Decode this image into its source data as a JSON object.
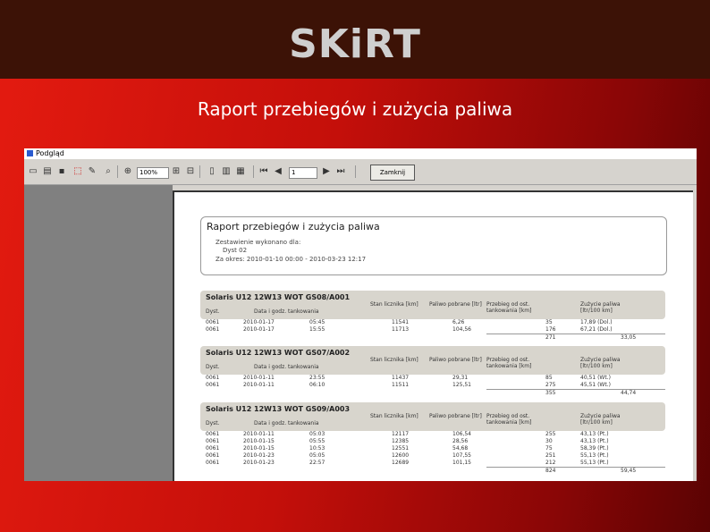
{
  "slide": {
    "brand": "SKiRT",
    "subtitle": "Raport przebiegów i zużycia paliwa"
  },
  "window": {
    "title": "Podgląd",
    "toolbar": {
      "zoom_value": "100%",
      "page_value": "1",
      "close_label": "Zamknij"
    }
  },
  "report": {
    "title": "Raport przebiegów i zużycia paliwa",
    "line1": "Zestawienie wykonano dla:",
    "line2": "Dyst 02",
    "line3": "Za okres: 2010-01-10 00:00 - 2010-03-23 12:17",
    "columns": [
      "Dyst.",
      "Data i godz. tankowania",
      "Stan licznika [km]",
      "Paliwo pobrane [ltr]",
      "Przebieg od ost. tankowania [km]",
      "Zużycie paliwa [ltr/100 km]"
    ],
    "groups": [
      {
        "name": "Solaris U12 12W13 WOT GS08/A001",
        "rows": [
          [
            "0061",
            "2010-01-17",
            "05:45",
            "11541",
            "6,26",
            "35",
            "17,89 (Dol.)"
          ],
          [
            "0061",
            "2010-01-17",
            "15:55",
            "11713",
            "104,56",
            "176",
            "67,21 (Dol.)"
          ]
        ],
        "sum": [
          "271",
          "33,05"
        ]
      },
      {
        "name": "Solaris U12 12W13 WOT GS07/A002",
        "rows": [
          [
            "0061",
            "2010-01-11",
            "23:55",
            "11437",
            "29,31",
            "85",
            "40,51 (Wt.)"
          ],
          [
            "0061",
            "2010-01-11",
            "06:10",
            "11511",
            "125,51",
            "275",
            "45,51 (Wt.)"
          ]
        ],
        "sum": [
          "355",
          "44,74"
        ]
      },
      {
        "name": "Solaris U12 12W13 WOT GS09/A003",
        "rows": [
          [
            "0061",
            "2010-01-11",
            "05:03",
            "12117",
            "106,54",
            "255",
            "43,13 (Pt.)"
          ],
          [
            "0061",
            "2010-01-15",
            "05:55",
            "12385",
            "28,56",
            "30",
            "43,13 (Pt.)"
          ],
          [
            "0061",
            "2010-01-15",
            "10:53",
            "12551",
            "54,68",
            "75",
            "58,39 (Pt.)"
          ],
          [
            "0061",
            "2010-01-23",
            "05:05",
            "12600",
            "107,55",
            "251",
            "55,13 (Pt.)"
          ],
          [
            "0061",
            "2010-01-23",
            "22:57",
            "12689",
            "101,15",
            "212",
            "55,13 (Pt.)"
          ]
        ],
        "sum": [
          "824",
          "59,45"
        ]
      }
    ]
  }
}
